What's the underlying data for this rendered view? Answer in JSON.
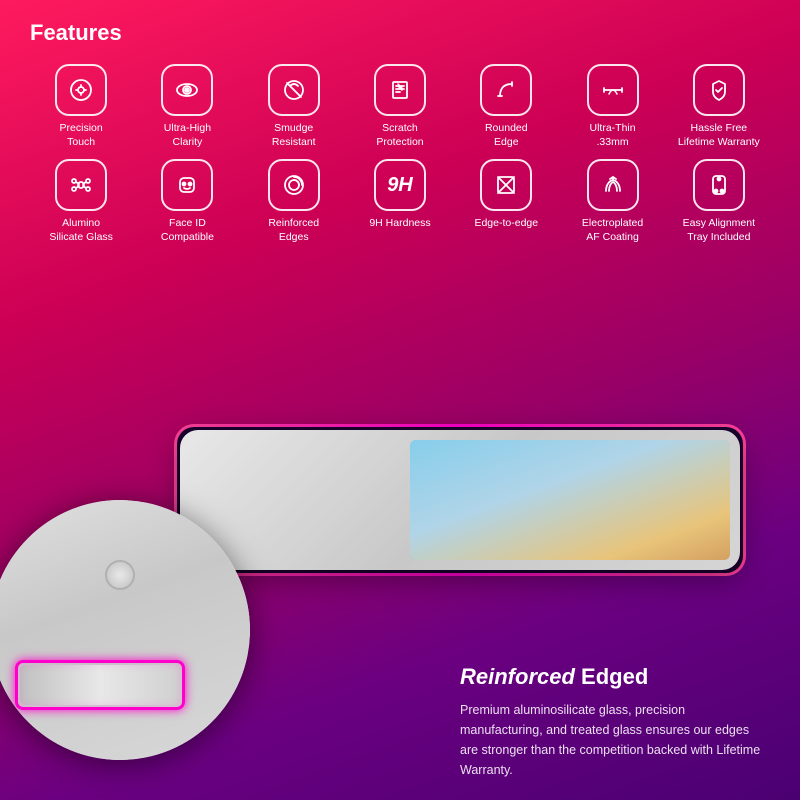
{
  "page": {
    "background": "gradient red to purple"
  },
  "features_section": {
    "title": "Features",
    "row1": [
      {
        "id": "precision-touch",
        "label": "Precision\nTouch",
        "icon": "precision"
      },
      {
        "id": "ultra-high-clarity",
        "label": "Ultra-High\nClarity",
        "icon": "clarity"
      },
      {
        "id": "smudge-resistant",
        "label": "Smudge\nResistant",
        "icon": "smudge"
      },
      {
        "id": "scratch-protection",
        "label": "Scratch\nProtection",
        "icon": "scratch"
      },
      {
        "id": "rounded-edge",
        "label": "Rounded\nEdge",
        "icon": "rounded"
      },
      {
        "id": "ultra-thin",
        "label": "Ultra-Thin\n.33mm",
        "icon": "thin"
      },
      {
        "id": "hassle-free",
        "label": "Hassle Free\nLifetime Warranty",
        "icon": "warranty"
      }
    ],
    "row2": [
      {
        "id": "alumino-silicate",
        "label": "Alumino\nSilicate Glass",
        "icon": "glass"
      },
      {
        "id": "face-id",
        "label": "Face ID\nCompatible",
        "icon": "faceid"
      },
      {
        "id": "reinforced-edges",
        "label": "Reinforced\nEdges",
        "icon": "reinforced"
      },
      {
        "id": "9h-hardness",
        "label": "9H Hardness",
        "icon": "9h"
      },
      {
        "id": "edge-to-edge",
        "label": "Edge-to-edge",
        "icon": "edge"
      },
      {
        "id": "electroplated",
        "label": "Electroplated\nAF Coating",
        "icon": "coating"
      },
      {
        "id": "easy-alignment",
        "label": "Easy Alignment\nTray Included",
        "icon": "alignment"
      }
    ]
  },
  "bottom_section": {
    "title_bold": "Reinforced",
    "title_normal": " Edged",
    "body": "Premium aluminosilicate glass, precision manufacturing, and treated glass ensures our edges are stronger than the competition backed with Lifetime Warranty."
  }
}
